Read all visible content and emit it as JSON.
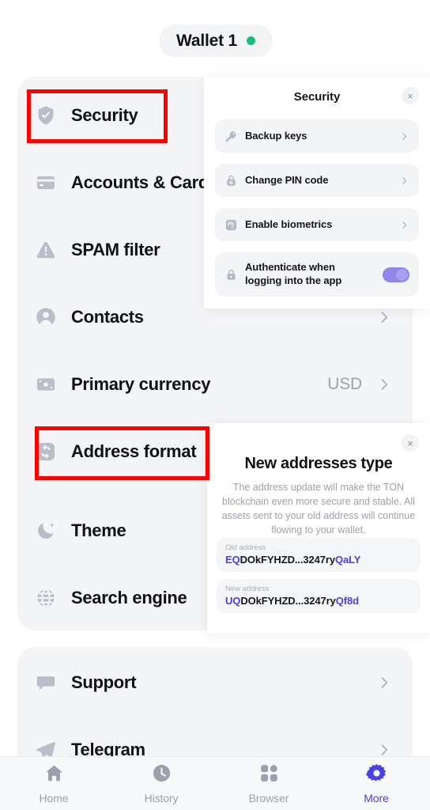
{
  "header": {
    "wallet_name": "Wallet 1",
    "status_dot_color": "#18c07a"
  },
  "settings": {
    "main_items": [
      {
        "label": "Security",
        "icon": "shield-check-icon",
        "value": "",
        "chevron": false
      },
      {
        "label": "Accounts & Cards",
        "icon": "credit-card-icon",
        "value": "",
        "chevron": false
      },
      {
        "label": "SPAM filter",
        "icon": "warning-icon",
        "value": "",
        "chevron": false
      },
      {
        "label": "Contacts",
        "icon": "person-icon",
        "value": "",
        "chevron": true
      },
      {
        "label": "Primary currency",
        "icon": "banknote-icon",
        "value": "USD",
        "chevron": true
      },
      {
        "label": "Address format",
        "icon": "refresh-icon",
        "value": "",
        "chevron": false
      },
      {
        "label": "Theme",
        "icon": "moon-icon",
        "value": "",
        "chevron": false
      },
      {
        "label": "Search engine",
        "icon": "globe-icon",
        "value": "",
        "chevron": false
      }
    ],
    "link_items": [
      {
        "label": "Support",
        "icon": "chat-bubble-icon",
        "chevron": true
      },
      {
        "label": "Telegram",
        "icon": "paper-plane-icon",
        "chevron": true
      }
    ]
  },
  "security_panel": {
    "title": "Security",
    "close_label": "×",
    "items": [
      {
        "label": "Backup keys",
        "icon": "key-icon",
        "control": "chevron"
      },
      {
        "label": "Change PIN code",
        "icon": "lock-clock-icon",
        "control": "chevron"
      },
      {
        "label": "Enable biometrics",
        "icon": "fingerprint-icon",
        "control": "chevron"
      },
      {
        "label": "Authenticate when logging into the app",
        "icon": "lock-icon",
        "control": "toggle",
        "toggle_on": true
      }
    ],
    "toggle_color": "#8f86e8"
  },
  "address_panel": {
    "close_label": "×",
    "title": "New addresses type",
    "description": "The address update will make the TON blockchain even more secure and stable. All assets sent to your old address will continue flowing to your wallet.",
    "old": {
      "label": "Old address",
      "prefix": "EQ",
      "middle": "DOkFYHZD...3247ry",
      "suffix": "QaLY"
    },
    "new": {
      "label": "New address",
      "prefix": "UQ",
      "middle": "DOkFYHZD...3247ry",
      "suffix": "Qf8d"
    },
    "highlight_color": "#4b3fe4"
  },
  "bottom_nav": {
    "active_color": "#4b40e0",
    "items": [
      {
        "label": "Home",
        "icon": "home-icon",
        "active": false
      },
      {
        "label": "History",
        "icon": "clock-icon",
        "active": false
      },
      {
        "label": "Browser",
        "icon": "grid-icon",
        "active": false
      },
      {
        "label": "More",
        "icon": "gear-icon",
        "active": true
      }
    ]
  }
}
